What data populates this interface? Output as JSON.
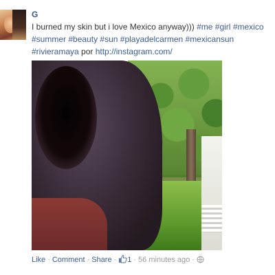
{
  "post": {
    "author_name": "G",
    "text_prefix": "I burned my skin but i love Mexico anyway))) ",
    "hashtags": [
      "#me",
      "#girl",
      "#mexico",
      "#summer",
      "#beauty",
      "#sun",
      "#playadelcarmen",
      "#mexicansun",
      "#rivieramaya"
    ],
    "by_word": " por ",
    "link": "http://instagram.com/",
    "photo_icon": "photo-of-person-outdoors"
  },
  "actions": {
    "like_label": "Like",
    "comment_label": "Comment",
    "share_label": "Share",
    "separator": "·",
    "like_count": "1",
    "timestamp": "56 minutes ago",
    "like_icon": "thumbs-up-icon",
    "privacy_icon": "globe-icon"
  },
  "colors": {
    "link": "#3b5998",
    "meta": "#999999",
    "text": "#333333"
  }
}
